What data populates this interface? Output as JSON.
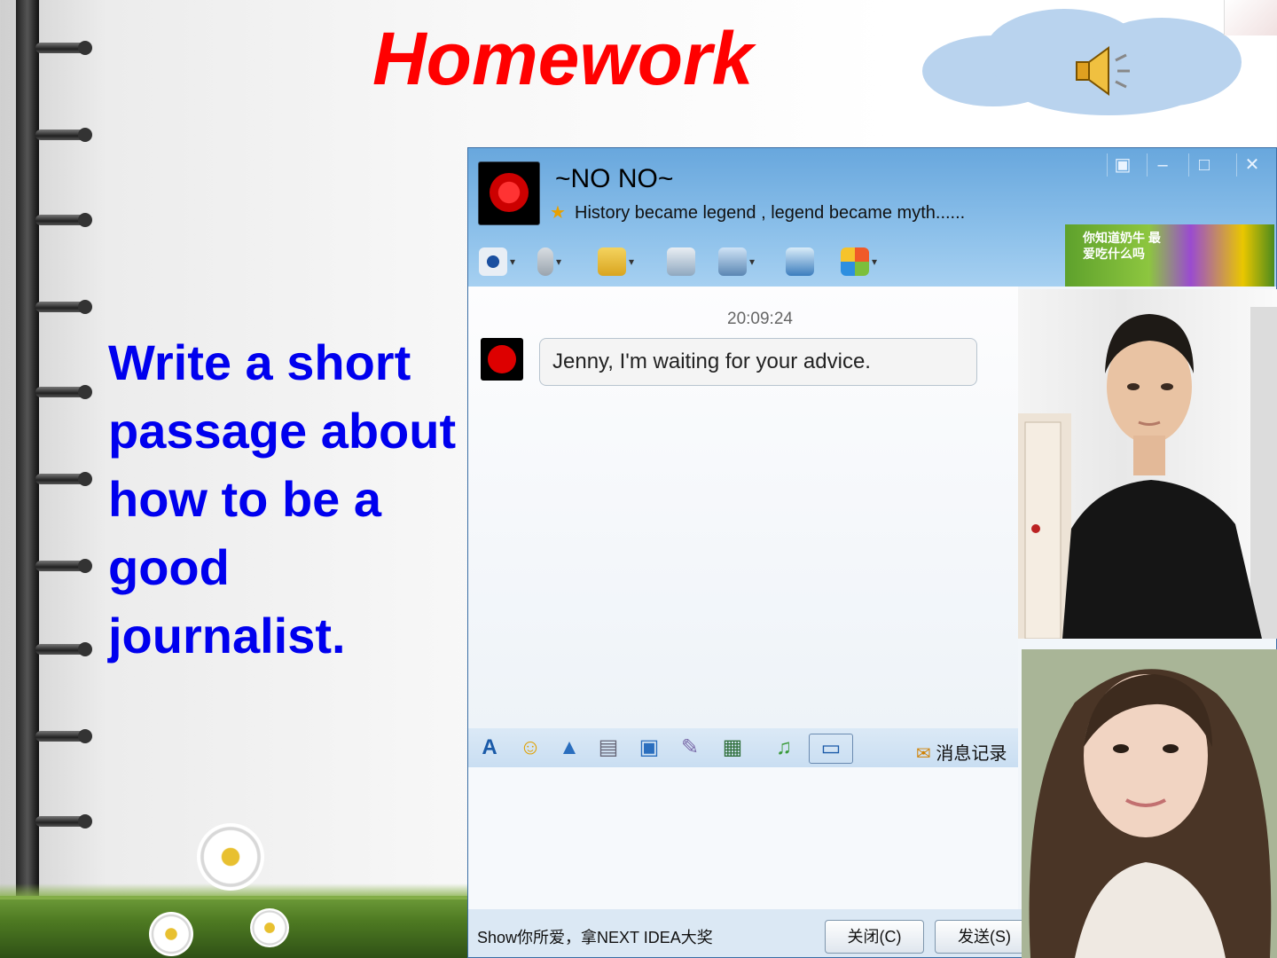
{
  "slide": {
    "title": "Homework",
    "lesson_text": "Write a short passage about how to be a good journalist."
  },
  "chat": {
    "contact_name": "~NO NO~",
    "signature": "History became legend , legend became myth......",
    "window_controls": [
      "▣",
      "–",
      "□",
      "✕"
    ],
    "toolbar_icons": [
      "webcam-icon",
      "microphone-icon",
      "file-transfer-icon",
      "add-member-icon",
      "remote-assist-icon",
      "screen-share-icon",
      "apps-icon"
    ],
    "ad_text": "你知道奶牛 最爱吃什么吗",
    "timestamp": "20:09:24",
    "message": "Jenny, I'm waiting for your advice.",
    "input_tools": [
      "font-icon",
      "emoji-icon",
      "shake-icon",
      "scroll-icon",
      "voice-icon",
      "edit-icon",
      "image-icon",
      "music-icon",
      "screenshot-icon"
    ],
    "history_label": "消息记录",
    "footer_ad": "Show你所爱，拿NEXT IDEA大奖",
    "close_button": "关闭(C)",
    "send_button": "发送(S)"
  },
  "colors": {
    "title": "#ff0000",
    "lesson": "#0000ee",
    "chat_header": "#7ab5e5"
  }
}
